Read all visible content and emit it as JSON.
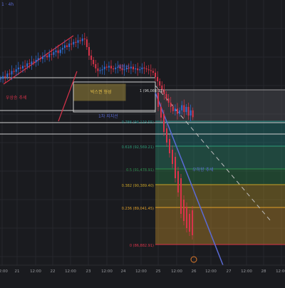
{
  "header": {
    "symbol_label": "1 · 4h"
  },
  "colors": {
    "background": "#1a1b1f",
    "candle_up": "#2e6fd8",
    "candle_down": "#d9334a",
    "trend_line": "#d9334a",
    "fib_line": "#5b6bd6",
    "channel": "#cfcfcf",
    "box": "#e2c24a",
    "projection": "#bdbdbd"
  },
  "labels": {
    "resistance": "저항선",
    "support": "1차 지지선",
    "box_range": "박스권 형성",
    "uptrend": "우상승 추세",
    "downtrend": "우하향 추세"
  },
  "chart_data": {
    "type": "candlestick",
    "xlabel": "",
    "ylabel": "",
    "x_ticks": [
      "12:00",
      "21",
      "12:00",
      "22",
      "12:00",
      "23",
      "12:00",
      "24",
      "12:00",
      "25",
      "12:00",
      "26",
      "12:00",
      "27",
      "12:00",
      "28",
      "12:00"
    ],
    "fib_levels": [
      {
        "label": "0.786 (94,119.55)",
        "ratio": 0.786,
        "value": 94119.55,
        "color": "#1f8c86"
      },
      {
        "label": "0.618 (92,569.21)",
        "ratio": 0.618,
        "value": 92569.21,
        "color": "#2e9c78"
      },
      {
        "label": "0.5 (91,478.91)",
        "ratio": 0.5,
        "value": 91478.91,
        "color": "#2f8f4e"
      },
      {
        "label": "0.382 (90,389.40)",
        "ratio": 0.382,
        "value": 90389.4,
        "color": "#c9a227"
      },
      {
        "label": "0.236 (89,041.45)",
        "ratio": 0.236,
        "value": 89041.45,
        "color": "#e0a02a"
      },
      {
        "label": "0 (86,882.91)",
        "ratio": 0,
        "value": 86882.91,
        "color": "#d9334a"
      }
    ],
    "fib_top_label": "1 (96,081.11)",
    "series": [
      {
        "closes": [
          33,
          36,
          35,
          39,
          38,
          42,
          41,
          44,
          46,
          45,
          48,
          47,
          51,
          50,
          53,
          52,
          55,
          57,
          56,
          59,
          60,
          58,
          62,
          61,
          64,
          66,
          63,
          67,
          69,
          72,
          70,
          74,
          73,
          76,
          75,
          78,
          77,
          80,
          79,
          70,
          60,
          55,
          50,
          45,
          42,
          43,
          44,
          47,
          46,
          48,
          45,
          44,
          46,
          47,
          45,
          43,
          44,
          46,
          45,
          47,
          44,
          45,
          43,
          44,
          46,
          45,
          44,
          43,
          42,
          40,
          35,
          30,
          25,
          20,
          15,
          10,
          5,
          0,
          -5,
          -2,
          -8,
          -4,
          2,
          -6,
          0,
          -10,
          -4,
          -12
        ]
      }
    ]
  }
}
